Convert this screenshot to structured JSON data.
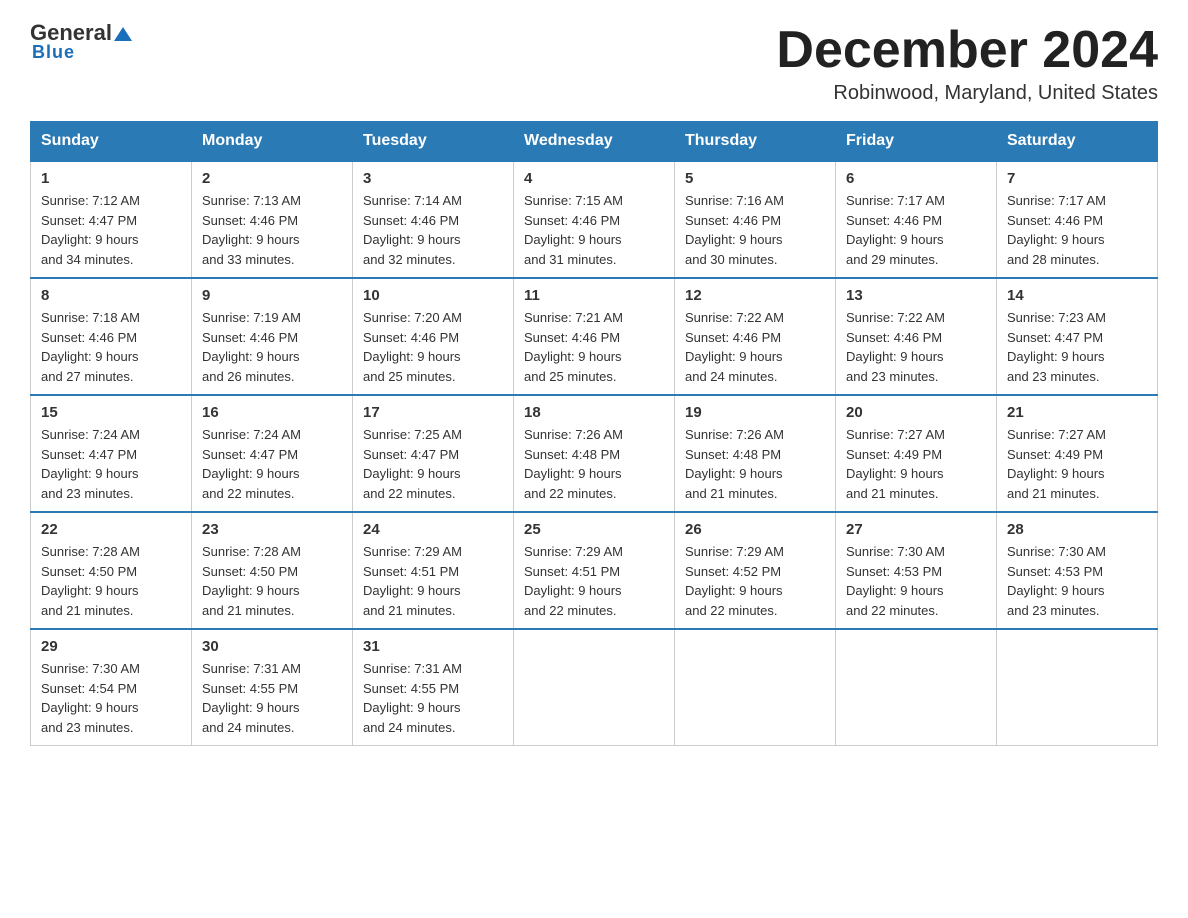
{
  "header": {
    "logo_general": "General",
    "logo_blue": "Blue",
    "month_title": "December 2024",
    "location": "Robinwood, Maryland, United States"
  },
  "days_of_week": [
    "Sunday",
    "Monday",
    "Tuesday",
    "Wednesday",
    "Thursday",
    "Friday",
    "Saturday"
  ],
  "weeks": [
    [
      {
        "num": "1",
        "sunrise": "7:12 AM",
        "sunset": "4:47 PM",
        "daylight": "9 hours and 34 minutes."
      },
      {
        "num": "2",
        "sunrise": "7:13 AM",
        "sunset": "4:46 PM",
        "daylight": "9 hours and 33 minutes."
      },
      {
        "num": "3",
        "sunrise": "7:14 AM",
        "sunset": "4:46 PM",
        "daylight": "9 hours and 32 minutes."
      },
      {
        "num": "4",
        "sunrise": "7:15 AM",
        "sunset": "4:46 PM",
        "daylight": "9 hours and 31 minutes."
      },
      {
        "num": "5",
        "sunrise": "7:16 AM",
        "sunset": "4:46 PM",
        "daylight": "9 hours and 30 minutes."
      },
      {
        "num": "6",
        "sunrise": "7:17 AM",
        "sunset": "4:46 PM",
        "daylight": "9 hours and 29 minutes."
      },
      {
        "num": "7",
        "sunrise": "7:17 AM",
        "sunset": "4:46 PM",
        "daylight": "9 hours and 28 minutes."
      }
    ],
    [
      {
        "num": "8",
        "sunrise": "7:18 AM",
        "sunset": "4:46 PM",
        "daylight": "9 hours and 27 minutes."
      },
      {
        "num": "9",
        "sunrise": "7:19 AM",
        "sunset": "4:46 PM",
        "daylight": "9 hours and 26 minutes."
      },
      {
        "num": "10",
        "sunrise": "7:20 AM",
        "sunset": "4:46 PM",
        "daylight": "9 hours and 25 minutes."
      },
      {
        "num": "11",
        "sunrise": "7:21 AM",
        "sunset": "4:46 PM",
        "daylight": "9 hours and 25 minutes."
      },
      {
        "num": "12",
        "sunrise": "7:22 AM",
        "sunset": "4:46 PM",
        "daylight": "9 hours and 24 minutes."
      },
      {
        "num": "13",
        "sunrise": "7:22 AM",
        "sunset": "4:46 PM",
        "daylight": "9 hours and 23 minutes."
      },
      {
        "num": "14",
        "sunrise": "7:23 AM",
        "sunset": "4:47 PM",
        "daylight": "9 hours and 23 minutes."
      }
    ],
    [
      {
        "num": "15",
        "sunrise": "7:24 AM",
        "sunset": "4:47 PM",
        "daylight": "9 hours and 23 minutes."
      },
      {
        "num": "16",
        "sunrise": "7:24 AM",
        "sunset": "4:47 PM",
        "daylight": "9 hours and 22 minutes."
      },
      {
        "num": "17",
        "sunrise": "7:25 AM",
        "sunset": "4:47 PM",
        "daylight": "9 hours and 22 minutes."
      },
      {
        "num": "18",
        "sunrise": "7:26 AM",
        "sunset": "4:48 PM",
        "daylight": "9 hours and 22 minutes."
      },
      {
        "num": "19",
        "sunrise": "7:26 AM",
        "sunset": "4:48 PM",
        "daylight": "9 hours and 21 minutes."
      },
      {
        "num": "20",
        "sunrise": "7:27 AM",
        "sunset": "4:49 PM",
        "daylight": "9 hours and 21 minutes."
      },
      {
        "num": "21",
        "sunrise": "7:27 AM",
        "sunset": "4:49 PM",
        "daylight": "9 hours and 21 minutes."
      }
    ],
    [
      {
        "num": "22",
        "sunrise": "7:28 AM",
        "sunset": "4:50 PM",
        "daylight": "9 hours and 21 minutes."
      },
      {
        "num": "23",
        "sunrise": "7:28 AM",
        "sunset": "4:50 PM",
        "daylight": "9 hours and 21 minutes."
      },
      {
        "num": "24",
        "sunrise": "7:29 AM",
        "sunset": "4:51 PM",
        "daylight": "9 hours and 21 minutes."
      },
      {
        "num": "25",
        "sunrise": "7:29 AM",
        "sunset": "4:51 PM",
        "daylight": "9 hours and 22 minutes."
      },
      {
        "num": "26",
        "sunrise": "7:29 AM",
        "sunset": "4:52 PM",
        "daylight": "9 hours and 22 minutes."
      },
      {
        "num": "27",
        "sunrise": "7:30 AM",
        "sunset": "4:53 PM",
        "daylight": "9 hours and 22 minutes."
      },
      {
        "num": "28",
        "sunrise": "7:30 AM",
        "sunset": "4:53 PM",
        "daylight": "9 hours and 23 minutes."
      }
    ],
    [
      {
        "num": "29",
        "sunrise": "7:30 AM",
        "sunset": "4:54 PM",
        "daylight": "9 hours and 23 minutes."
      },
      {
        "num": "30",
        "sunrise": "7:31 AM",
        "sunset": "4:55 PM",
        "daylight": "9 hours and 24 minutes."
      },
      {
        "num": "31",
        "sunrise": "7:31 AM",
        "sunset": "4:55 PM",
        "daylight": "9 hours and 24 minutes."
      },
      null,
      null,
      null,
      null
    ]
  ],
  "labels": {
    "sunrise": "Sunrise:",
    "sunset": "Sunset:",
    "daylight": "Daylight:"
  }
}
